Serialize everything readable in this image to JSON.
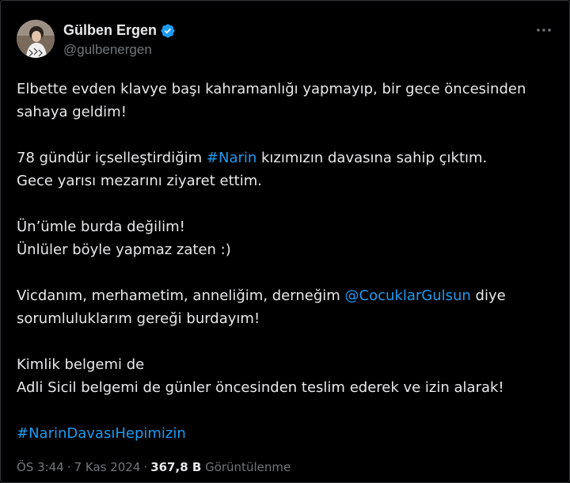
{
  "author": {
    "display_name": "Gülben Ergen",
    "handle": "@gulbenergen",
    "avatar_icon": "profile-photo",
    "verified_icon": "verified-badge-icon",
    "verified_color": "#1d9bf0"
  },
  "more_icon": "more-options-icon",
  "post": {
    "p1": {
      "l1": "Elbette evden klavye başı kahramanlığı yapmayıp, bir gece öncesinden",
      "l2": "sahaya geldim!"
    },
    "p2": {
      "l1_pre": "78 gündür içselleştirdiğim ",
      "l1_hashtag": "#Narin",
      "l1_post": " kızımızın davasına sahip çıktım.",
      "l2": "Gece yarısı mezarını ziyaret ettim."
    },
    "p3": {
      "l1": "Ün’ümle burda değilim!",
      "l2": "Ünlüler böyle yapmaz zaten :)"
    },
    "p4": {
      "l1_pre": "Vicdanım, merhametim, anneliğim, derneğim ",
      "l1_mention": "@CocuklarGulsun",
      "l1_post": " diye",
      "l2": "sorumluluklarım gereği burdayım!"
    },
    "p5": {
      "l1": "Kimlik belgemi de",
      "l2": "Adli Sicil belgemi de günler öncesinden teslim ederek ve izin alarak!"
    },
    "p6": {
      "hashtag": "#NarinDavasıHepimizin"
    }
  },
  "meta": {
    "time": "ÖS 3:44",
    "separator": "·",
    "date": "7 Kas 2024",
    "views_count": "367,8 B",
    "views_label": "Görüntülenme"
  },
  "colors": {
    "background": "#000000",
    "text": "#e7e9ea",
    "secondary": "#71767b",
    "link": "#1d9bf0"
  }
}
